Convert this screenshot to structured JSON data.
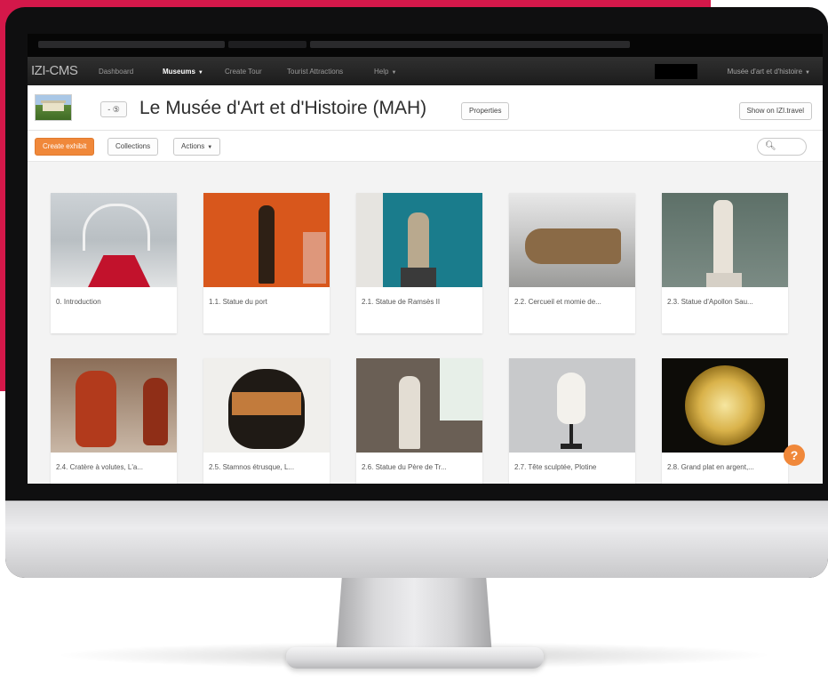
{
  "navbar": {
    "brand": "IZI-CMS",
    "items": [
      {
        "label": "Dashboard"
      },
      {
        "label": "Museums",
        "active": true,
        "dropdown": true
      },
      {
        "label": "Create Tour"
      },
      {
        "label": "Tourist Attractions"
      },
      {
        "label": "Help",
        "dropdown": true
      }
    ],
    "museum_selector": "Musée d'art et d'histoire"
  },
  "title_bar": {
    "language_button": "- ⑤",
    "title": "Le Musée d'Art et d'Histoire (MAH)",
    "properties_button": "Properties",
    "show_button": "Show on IZI.travel"
  },
  "toolbar": {
    "create_label": "Create exhibit",
    "collections_label": "Collections",
    "actions_label": "Actions",
    "search_icon": "search-icon"
  },
  "exhibits": [
    {
      "caption": "0. Introduction"
    },
    {
      "caption": "1.1. Statue du port"
    },
    {
      "caption": "2.1. Statue de Ramsès II"
    },
    {
      "caption": "2.2. Cercueil et momie de..."
    },
    {
      "caption": "2.3. Statue d'Apollon Sau..."
    },
    {
      "caption": "2.4. Cratère à volutes, L'a..."
    },
    {
      "caption": "2.5. Stamnos étrusque, L..."
    },
    {
      "caption": "2.6. Statue du Père de Tr..."
    },
    {
      "caption": "2.7. Tête sculptée, Plotine"
    },
    {
      "caption": "2.8. Grand plat en argent,..."
    }
  ],
  "help_button": "?",
  "colors": {
    "accent": "#f0883a",
    "brand_red": "#d4184a",
    "navbar": "#1c1c1c"
  }
}
